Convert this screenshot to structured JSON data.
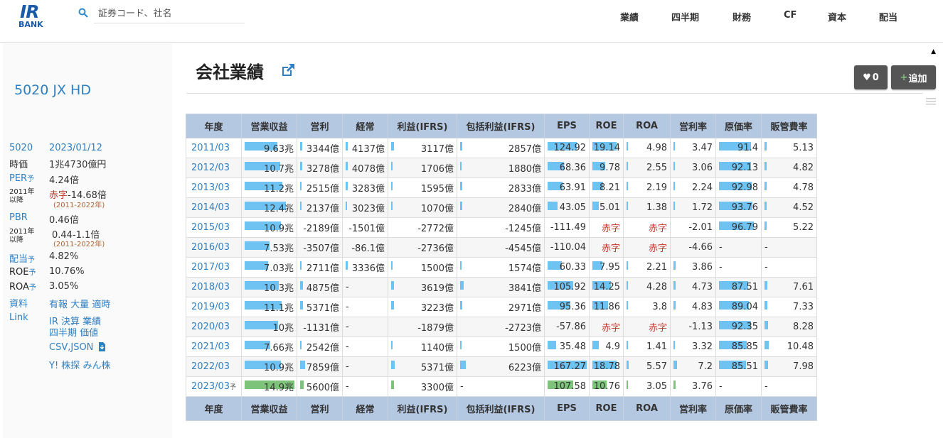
{
  "header": {
    "logo_top": "IR",
    "logo_bottom": "BANK",
    "search_placeholder": "証券コード、社名",
    "nav": [
      "業績",
      "四半期",
      "財務",
      "CF",
      "資本",
      "配当"
    ]
  },
  "sidebar": {
    "company": "5020 JX HD",
    "code": "5020",
    "date": "2023/01/12",
    "market_cap_label": "時価",
    "market_cap": "1兆4730億円",
    "per_label": "PER",
    "per_suffix": "予",
    "per": "4.24倍",
    "per_hist_label1": "2011年",
    "per_hist_label2": "以降",
    "per_hist_prefix": "赤字",
    "per_hist": "-14.68倍",
    "per_hist_range": "(2011-2022年)",
    "pbr_label": "PBR",
    "pbr": "0.46倍",
    "pbr_hist_label1": "2011年",
    "pbr_hist_label2": "以降",
    "pbr_hist": "0.44-1.1倍",
    "pbr_hist_range": "(2011-2022年)",
    "div_label": "配当",
    "div_suffix": "予",
    "div": "4.82%",
    "roe_label": "ROE",
    "roe_suffix": "予",
    "roe": "10.76%",
    "roa_label": "ROA",
    "roa_suffix": "予",
    "roa": "3.05%",
    "docs_label": "資料",
    "docs": [
      "有報",
      "大量",
      "適時"
    ],
    "link_label": "Link",
    "links_row1": [
      "IR",
      "決算",
      "業績"
    ],
    "links_row2": [
      "四半期",
      "価値"
    ],
    "csv": "CSV,JSON",
    "links_row4": [
      "Y!",
      "株探",
      "みん株"
    ]
  },
  "main": {
    "title": "会社業績",
    "like_count": "0",
    "add_label": "追加",
    "columns": [
      "年度",
      "営業収益",
      "営利",
      "経常",
      "利益(IFRS)",
      "包括利益(IFRS)",
      "EPS",
      "ROE",
      "ROA",
      "営利率",
      "原価率",
      "販管費率"
    ],
    "rows": [
      [
        "2011/03",
        "9.63兆",
        "3344億",
        "4137億",
        "3117億",
        "2857億",
        "124.92",
        "19.14",
        "4.98",
        "3.47",
        "91.4",
        "5.13"
      ],
      [
        "2012/03",
        "10.7兆",
        "3278億",
        "4078億",
        "1706億",
        "1880億",
        "68.36",
        "9.78",
        "2.55",
        "3.06",
        "92.13",
        "4.82"
      ],
      [
        "2013/03",
        "11.2兆",
        "2515億",
        "3283億",
        "1595億",
        "2833億",
        "63.91",
        "8.21",
        "2.19",
        "2.24",
        "92.98",
        "4.78"
      ],
      [
        "2014/03",
        "12.4兆",
        "2137億",
        "3023億",
        "1070億",
        "2840億",
        "43.05",
        "5.01",
        "1.38",
        "1.72",
        "93.76",
        "4.52"
      ],
      [
        "2015/03",
        "10.9兆",
        "-2189億",
        "-1501億",
        "-2772億",
        "-1245億",
        "-111.49",
        "赤字",
        "赤字",
        "-2.01",
        "96.79",
        "5.22"
      ],
      [
        "2016/03",
        "7.53兆",
        "-3507億",
        "-86.1億",
        "-2736億",
        "-4545億",
        "-110.04",
        "赤字",
        "赤字",
        "-4.66",
        "-",
        "-"
      ],
      [
        "2017/03",
        "7.03兆",
        "2711億",
        "3336億",
        "1500億",
        "1574億",
        "60.33",
        "7.95",
        "2.21",
        "3.86",
        "-",
        "-"
      ],
      [
        "2018/03",
        "10.3兆",
        "4875億",
        "-",
        "3619億",
        "3841億",
        "105.92",
        "14.25",
        "4.28",
        "4.73",
        "87.51",
        "7.61"
      ],
      [
        "2019/03",
        "11.1兆",
        "5371億",
        "-",
        "3223億",
        "2971億",
        "95.36",
        "11.86",
        "3.8",
        "4.83",
        "89.04",
        "7.33"
      ],
      [
        "2020/03",
        "10兆",
        "-1131億",
        "-",
        "-1879億",
        "-2723億",
        "-57.86",
        "赤字",
        "赤字",
        "-1.13",
        "92.35",
        "8.28"
      ],
      [
        "2021/03",
        "7.66兆",
        "2542億",
        "-",
        "1140億",
        "1500億",
        "35.48",
        "4.9",
        "1.41",
        "3.32",
        "85.85",
        "10.48"
      ],
      [
        "2022/03",
        "10.9兆",
        "7859億",
        "-",
        "5371億",
        "6223億",
        "167.27",
        "18.78",
        "5.57",
        "7.2",
        "85.51",
        "7.98"
      ],
      [
        "2023/03",
        "14.9兆",
        "5600億",
        "-",
        "3300億",
        "-",
        "107.58",
        "10.76",
        "3.05",
        "3.76",
        "-",
        "-"
      ]
    ],
    "forecast_suffix": "予",
    "bar_fractions": [
      [
        0.65,
        0.05,
        0.06,
        0.04,
        0.03,
        0.75,
        0.85,
        0.04,
        0.04,
        0.8,
        0.04
      ],
      [
        0.72,
        0.05,
        0.06,
        0.02,
        0.02,
        0.42,
        0.44,
        0.02,
        0.04,
        0.8,
        0.04
      ],
      [
        0.75,
        0.04,
        0.05,
        0.02,
        0.03,
        0.39,
        0.37,
        0.02,
        0.03,
        0.82,
        0.04
      ],
      [
        0.83,
        0.03,
        0.04,
        0.01,
        0.03,
        0.26,
        0.23,
        0.01,
        0.02,
        0.84,
        0.04
      ],
      [
        0.73,
        0,
        0,
        0,
        0,
        0,
        0,
        0,
        0,
        0.88,
        0.04
      ],
      [
        0.5,
        0,
        0,
        0,
        0,
        0,
        0,
        0,
        0,
        0,
        0
      ],
      [
        0.47,
        0.04,
        0.05,
        0.02,
        0.02,
        0.37,
        0.36,
        0.02,
        0.05,
        0,
        0
      ],
      [
        0.69,
        0.07,
        0,
        0.04,
        0.04,
        0.65,
        0.65,
        0.04,
        0.06,
        0.73,
        0.06
      ],
      [
        0.74,
        0.08,
        0,
        0.04,
        0.03,
        0.58,
        0.54,
        0.04,
        0.06,
        0.75,
        0.06
      ],
      [
        0.67,
        0,
        0,
        0,
        0,
        0,
        0,
        0,
        0,
        0.8,
        0.07
      ],
      [
        0.51,
        0.04,
        0,
        0.01,
        0.02,
        0.22,
        0.22,
        0.01,
        0.04,
        0.69,
        0.09
      ],
      [
        0.73,
        0.12,
        0,
        0.06,
        0.07,
        1.0,
        0.85,
        0.06,
        0.09,
        0.68,
        0.07
      ],
      [
        1.0,
        0.09,
        0,
        0.04,
        0,
        0.66,
        0.49,
        0.03,
        0.05,
        0,
        0
      ]
    ],
    "colors": {
      "bar": "#6ec3f2",
      "forecast_bar": "#7dc47a",
      "header_bg": "#b5c8e2",
      "link": "#2f7fc1",
      "deficit": "#c0392b"
    }
  }
}
